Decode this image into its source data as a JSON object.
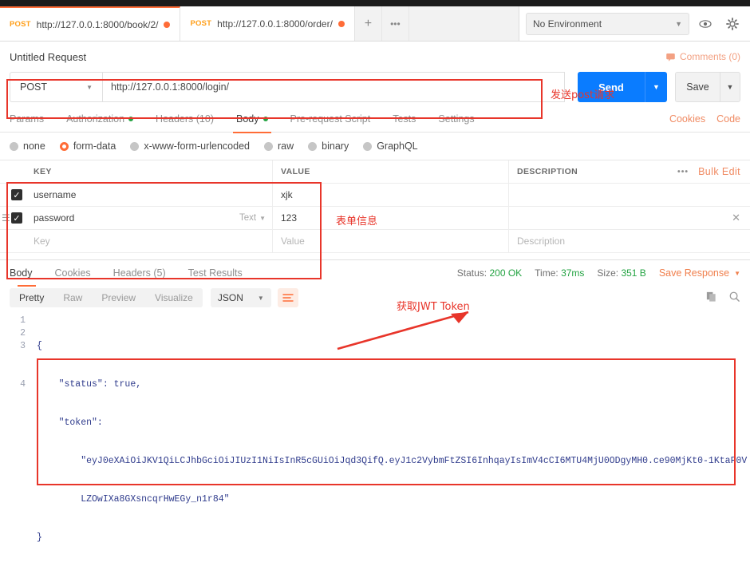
{
  "window": {
    "tabs": [
      {
        "method": "POST",
        "url": "http://127.0.0.1:8000/book/2/",
        "active": true
      },
      {
        "method": "POST",
        "url": "http://127.0.0.1:8000/order/",
        "active": false
      }
    ],
    "new_tab_label": "+",
    "more_tabs_label": "•••",
    "environment": "No Environment",
    "eye_icon": "eye-icon",
    "gear_icon": "gear-icon"
  },
  "request": {
    "title": "Untitled Request",
    "comments_label": "Comments (0)",
    "method": "POST",
    "url": "http://127.0.0.1:8000/login/",
    "send_label": "Send",
    "save_label": "Save",
    "tabs": [
      {
        "label": "Params",
        "dot": "",
        "active": false
      },
      {
        "label": "Authorization",
        "dot": "green",
        "active": false
      },
      {
        "label": "Headers (10)",
        "dot": "",
        "active": false
      },
      {
        "label": "Body",
        "dot": "green",
        "active": true
      },
      {
        "label": "Pre-request Script",
        "dot": "",
        "active": false
      },
      {
        "label": "Tests",
        "dot": "",
        "active": false
      },
      {
        "label": "Settings",
        "dot": "",
        "active": false
      }
    ],
    "links": [
      "Cookies",
      "Code"
    ],
    "body_types": [
      {
        "label": "none",
        "selected": false
      },
      {
        "label": "form-data",
        "selected": true
      },
      {
        "label": "x-www-form-urlencoded",
        "selected": false
      },
      {
        "label": "raw",
        "selected": false
      },
      {
        "label": "binary",
        "selected": false
      },
      {
        "label": "GraphQL",
        "selected": false
      }
    ],
    "table": {
      "headers": {
        "key": "KEY",
        "value": "VALUE",
        "description": "DESCRIPTION"
      },
      "more_label": "•••",
      "bulk_edit_label": "Bulk Edit",
      "rows": [
        {
          "checked": true,
          "key": "username",
          "type": "",
          "value": "xjk",
          "description": ""
        },
        {
          "checked": true,
          "key": "password",
          "type": "Text",
          "value": "123",
          "description": ""
        }
      ],
      "placeholder_row": {
        "key": "Key",
        "value": "Value",
        "description": "Description"
      }
    }
  },
  "response": {
    "tabs": [
      {
        "label": "Body",
        "active": true
      },
      {
        "label": "Cookies",
        "active": false
      },
      {
        "label": "Headers (5)",
        "active": false
      },
      {
        "label": "Test Results",
        "active": false
      }
    ],
    "status_label": "Status:",
    "status_value": "200 OK",
    "time_label": "Time:",
    "time_value": "37ms",
    "size_label": "Size:",
    "size_value": "351 B",
    "save_response_label": "Save Response",
    "view_tabs": [
      {
        "label": "Pretty",
        "active": true
      },
      {
        "label": "Raw",
        "active": false
      },
      {
        "label": "Preview",
        "active": false
      },
      {
        "label": "Visualize",
        "active": false
      }
    ],
    "format": "JSON",
    "wrap_icon": "word-wrap-icon",
    "copy_icon": "copy-icon",
    "search_icon": "search-icon",
    "line_numbers": [
      "1",
      "2",
      "3",
      "4"
    ],
    "body_lines": [
      "{",
      "    \"status\": true,",
      "    \"token\":",
      "        \"eyJ0eXAiOiJKV1QiLCJhbGciOiJIUzI1NiIsInR5cGUiOiJqd3QifQ.eyJ1c2VybmFtZSI6InhqayIsImV4cCI6MTU4MjU0ODgyMH0.ce90MjKt0-1KtaF0V",
      "        LZOwIXa8GXsncqrHwEGy_n1r84\"",
      "}"
    ]
  },
  "annotations": {
    "send_post": "发送post请求",
    "form_info": "表单信息",
    "jwt_token": "获取JWT Token",
    "color": "#e8352a"
  }
}
